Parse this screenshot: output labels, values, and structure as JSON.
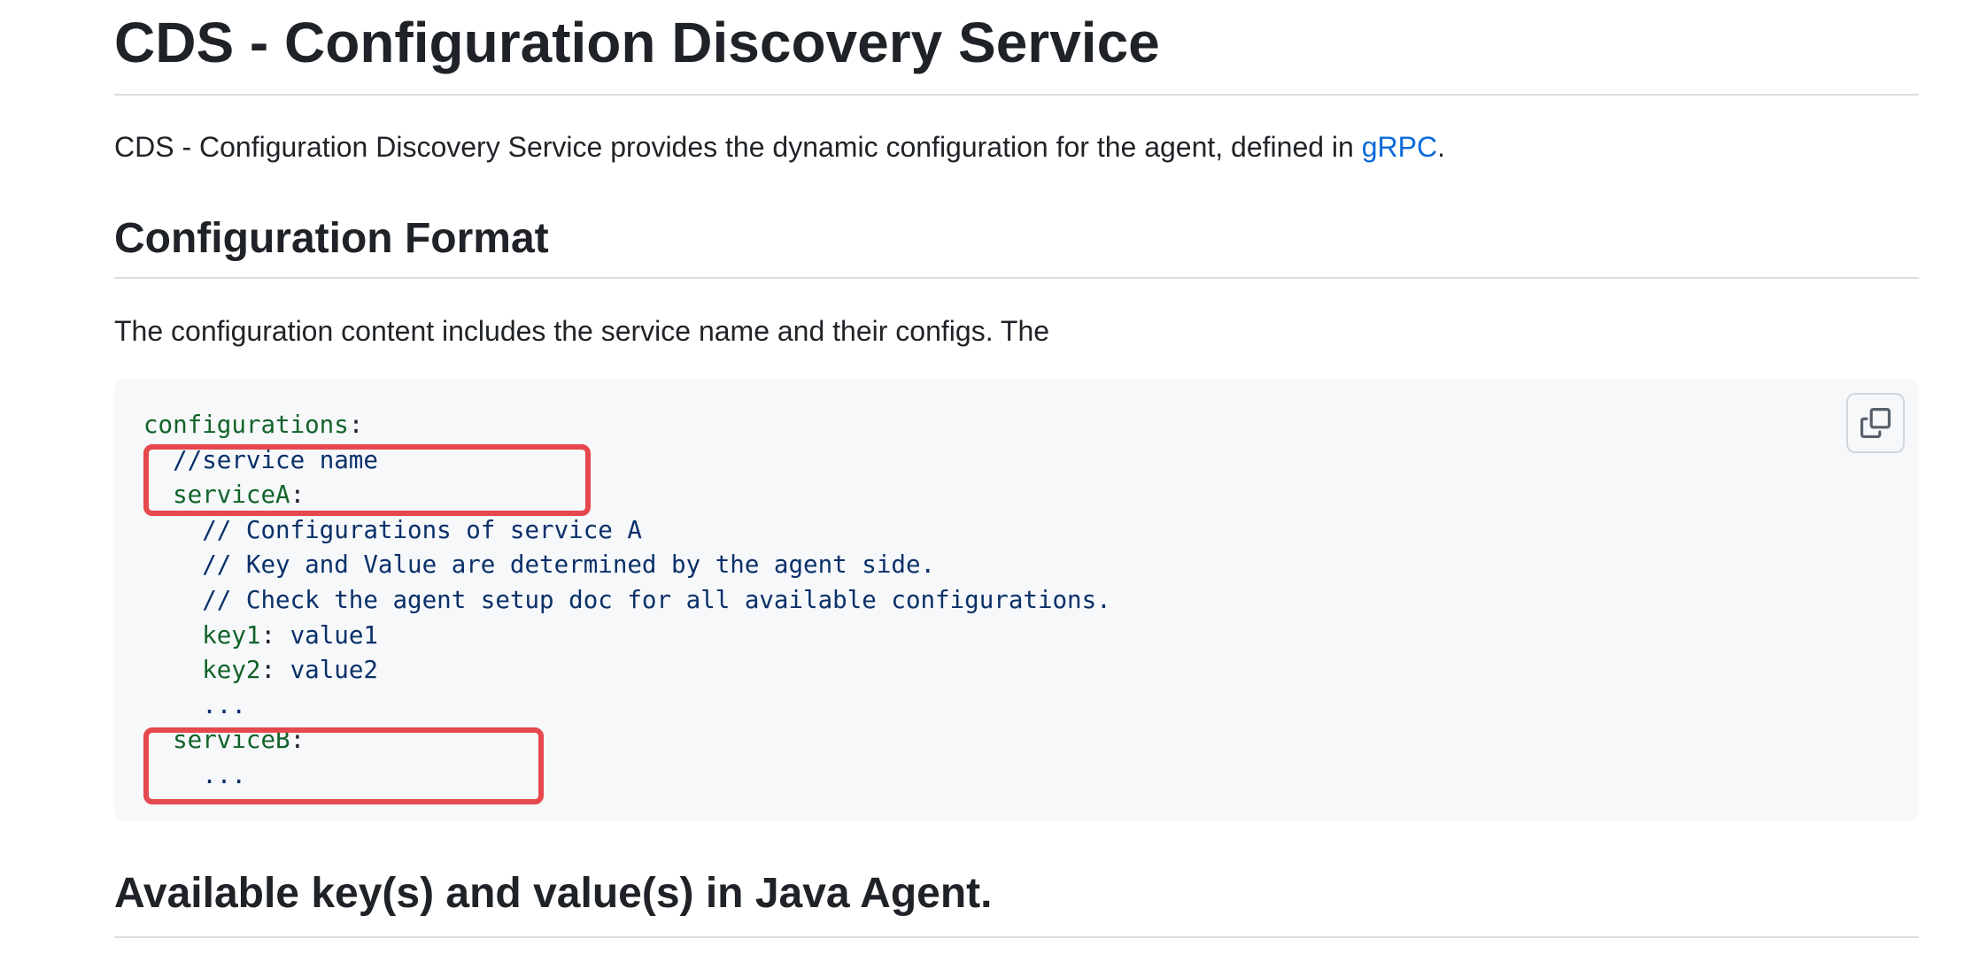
{
  "page": {
    "title": "CDS - Configuration Discovery Service",
    "intro": {
      "text_before": "CDS - Configuration Discovery Service provides the dynamic configuration for the agent, defined in ",
      "link": "gRPC",
      "text_after": "."
    },
    "section1": {
      "heading": "Configuration Format",
      "description": "The configuration content includes the service name and their configs. The"
    },
    "section2": {
      "heading": "Available key(s) and value(s) in Java Agent."
    }
  },
  "code": {
    "copy_button_icon": "copy-icon",
    "lines": [
      {
        "indent": "",
        "key": "configurations",
        "sep": ":",
        "rest": ""
      },
      {
        "indent": "  ",
        "key": "",
        "sep": "",
        "rest": "//service name"
      },
      {
        "indent": "  ",
        "key": "serviceA",
        "sep": ":",
        "rest": ""
      },
      {
        "indent": "    ",
        "key": "",
        "sep": "",
        "rest": "// Configurations of service A"
      },
      {
        "indent": "    ",
        "key": "",
        "sep": "",
        "rest": "// Key and Value are determined by the agent side."
      },
      {
        "indent": "    ",
        "key": "",
        "sep": "",
        "rest": "// Check the agent setup doc for all available configurations."
      },
      {
        "indent": "    ",
        "key": "key1",
        "sep": ": ",
        "rest": "value1"
      },
      {
        "indent": "    ",
        "key": "key2",
        "sep": ": ",
        "rest": "value2"
      },
      {
        "indent": "    ",
        "key": "",
        "sep": "",
        "rest": "..."
      },
      {
        "indent": "  ",
        "key": "serviceB",
        "sep": ":",
        "rest": ""
      },
      {
        "indent": "    ",
        "key": "",
        "sep": "",
        "rest": "..."
      }
    ]
  },
  "colors": {
    "highlight": "#e5484d",
    "link": "#0969da",
    "key": "#116329",
    "comment": "#0a3069"
  }
}
